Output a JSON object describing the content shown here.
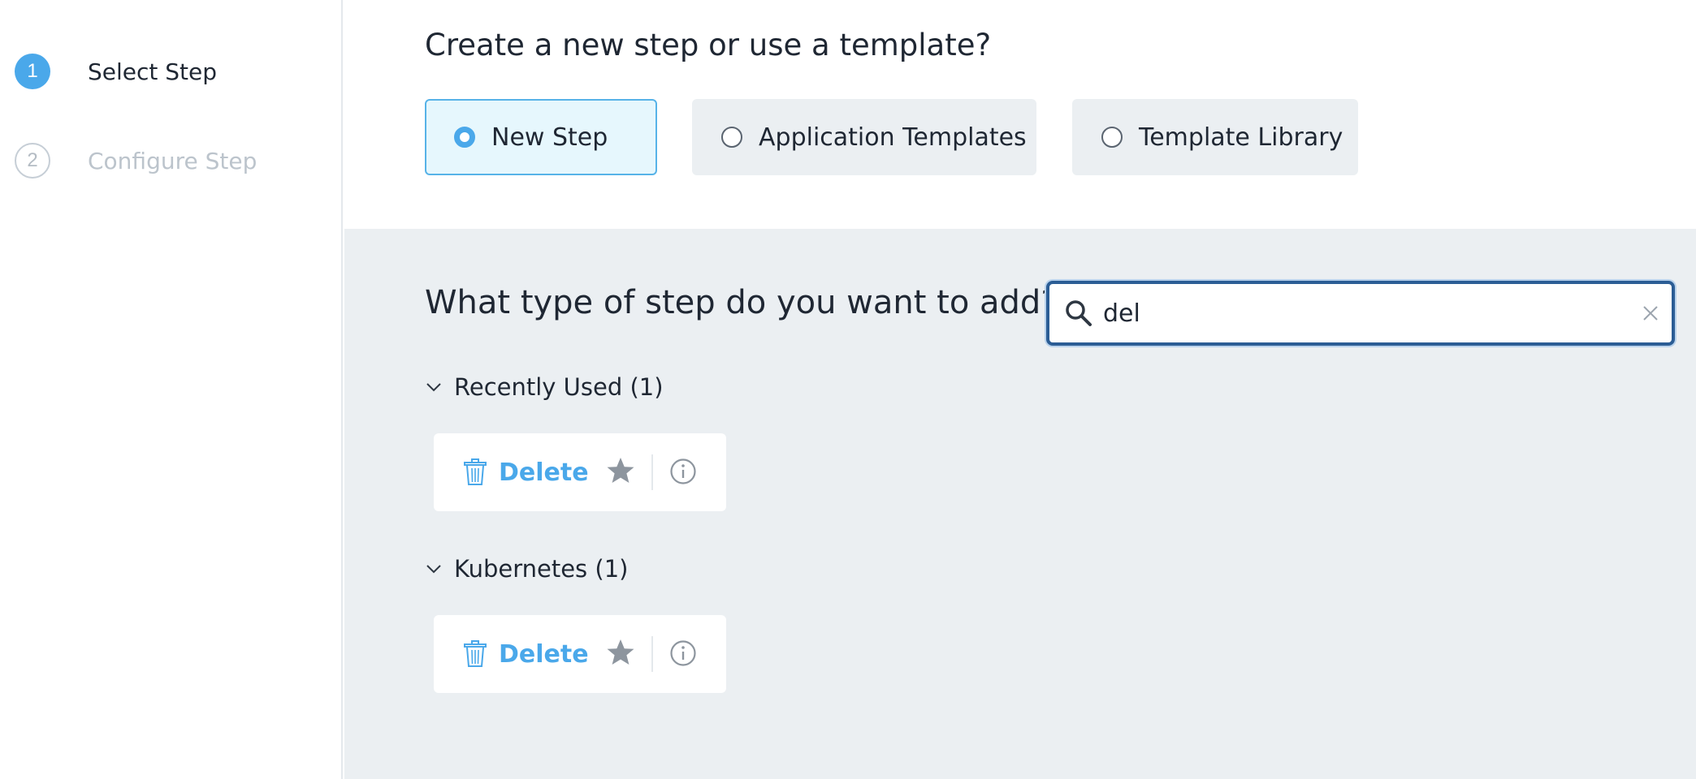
{
  "wizard": {
    "steps": [
      {
        "number": "1",
        "label": "Select Step",
        "active": true
      },
      {
        "number": "2",
        "label": "Configure Step",
        "active": false
      }
    ]
  },
  "source": {
    "title": "Create a new step or use a template?",
    "options": [
      {
        "label": "New Step",
        "selected": true
      },
      {
        "label": "Application Templates",
        "selected": false
      },
      {
        "label": "Template Library",
        "selected": false
      }
    ]
  },
  "main": {
    "question": "What type of step do you want to add?",
    "search": {
      "value": "del"
    },
    "groups": [
      {
        "title": "Recently Used (1)",
        "items": [
          {
            "label": "Delete",
            "icon": "trash-icon"
          }
        ]
      },
      {
        "title": "Kubernetes (1)",
        "items": [
          {
            "label": "Delete",
            "icon": "trash-icon"
          }
        ]
      }
    ]
  },
  "colors": {
    "accent": "#4aa8ea",
    "search_border": "#2b5d95",
    "panel_background": "#ebeff2",
    "selected_card_background": "#e6f7fd"
  }
}
